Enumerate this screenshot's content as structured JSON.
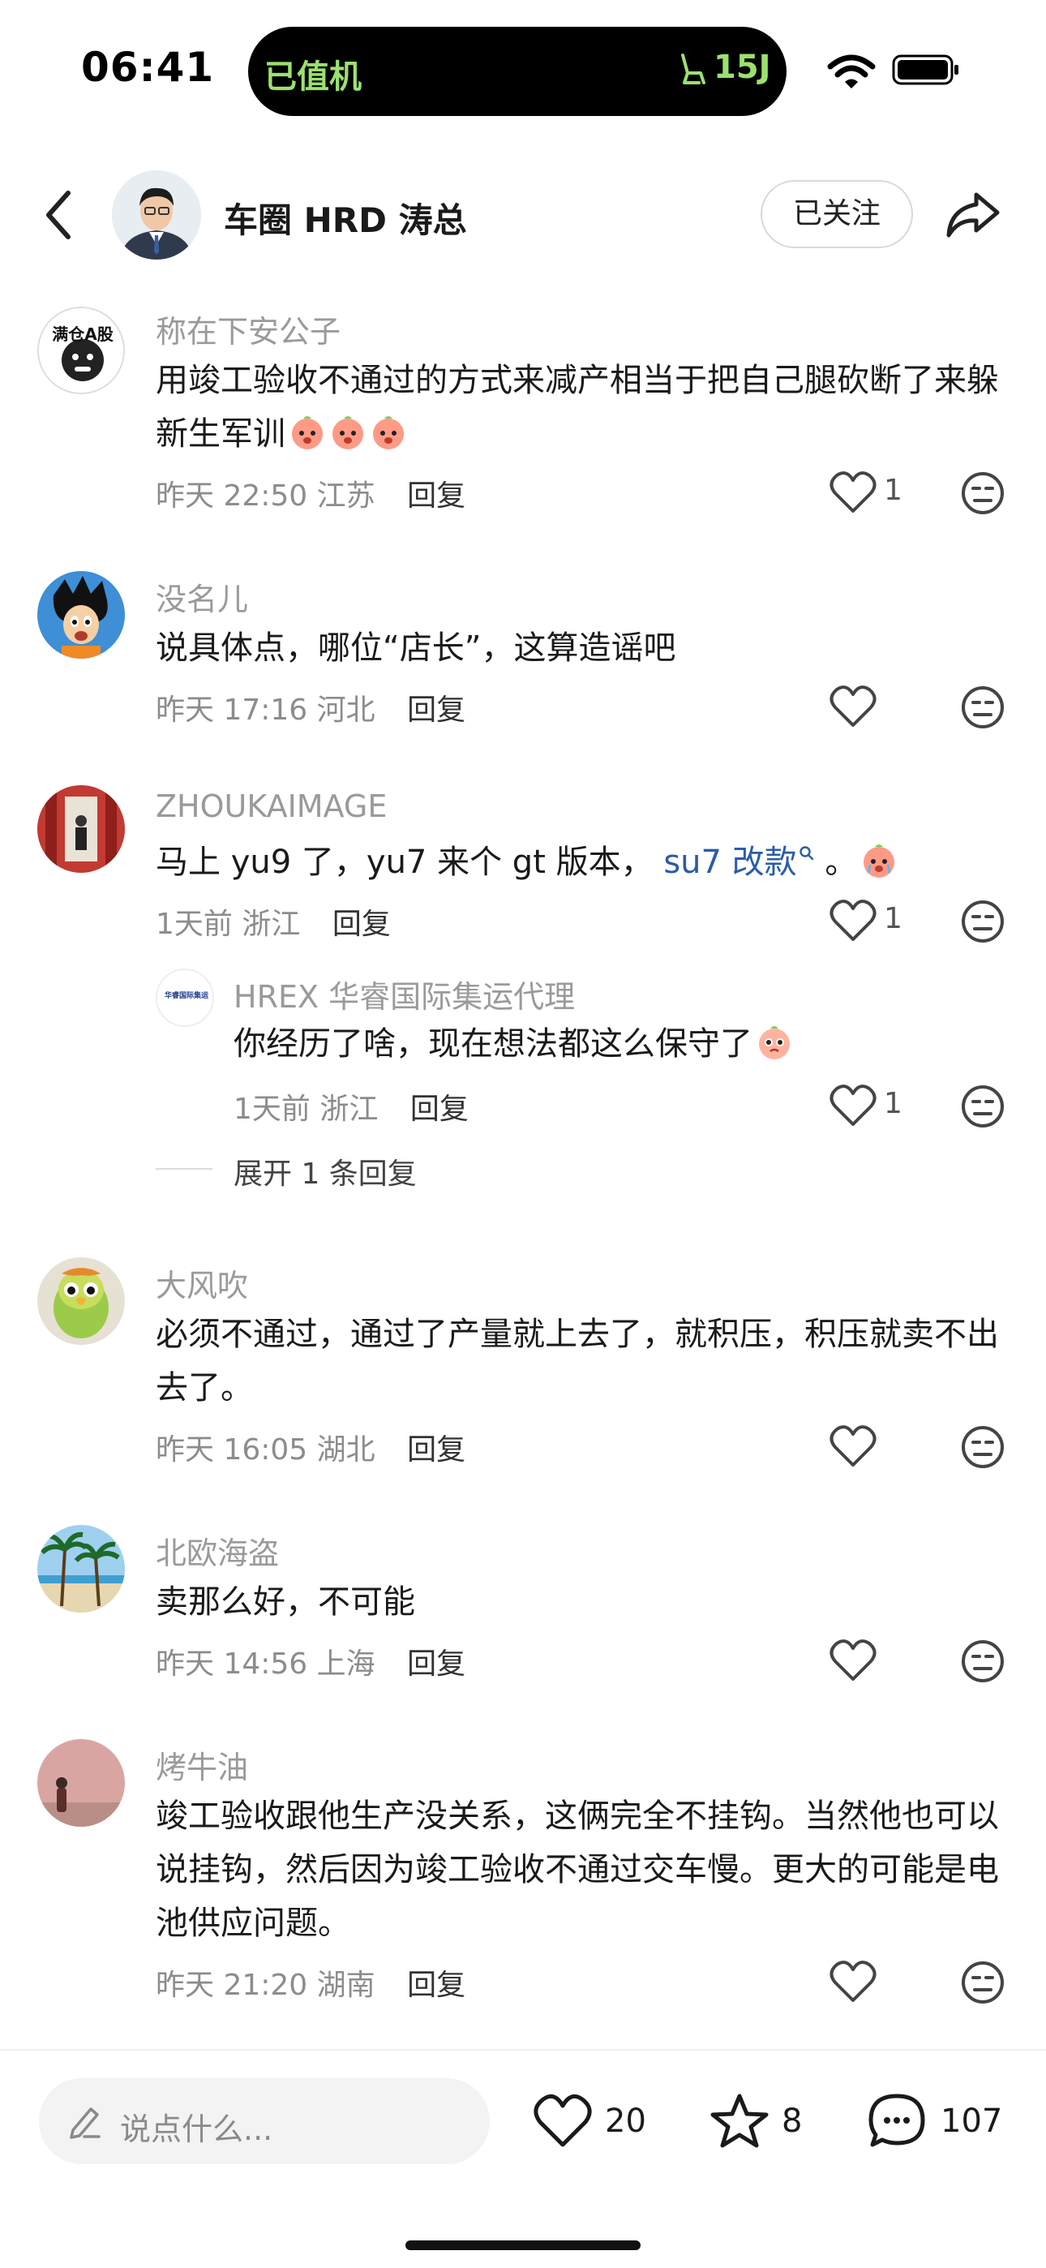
{
  "status": {
    "time": "06:41",
    "island_label": "已值机",
    "seat_icon": "seat-icon",
    "flight": "15J"
  },
  "header": {
    "author": "车圈 HRD 涛总",
    "follow_label": "已关注"
  },
  "comments": [
    {
      "user": "称在下安公子",
      "avatar_text": "满仓A股",
      "text": "用竣工验收不通过的方式来减产相当于把自己腿砍断了来躲新生军训",
      "time": "昨天 22:50",
      "location": "江苏",
      "reply": "回复",
      "likes": "1"
    },
    {
      "user": "没名儿",
      "text": "说具体点，哪位“店长”，这算造谣吧",
      "time": "昨天 17:16",
      "location": "河北",
      "reply": "回复",
      "likes": ""
    },
    {
      "user": "ZHOUKAIMAGE",
      "text_before": "马上 yu9 了，yu7 来个 gt 版本，",
      "link": "su7 改款",
      "text_after": "。",
      "time": "1天前",
      "location": "浙江",
      "reply": "回复",
      "likes": "1"
    },
    {
      "user": "大风吹",
      "text": "必须不通过，通过了产量就上去了，就积压，积压就卖不出去了。",
      "time": "昨天 16:05",
      "location": "湖北",
      "reply": "回复",
      "likes": ""
    },
    {
      "user": "北欧海盗",
      "text": "卖那么好，不可能",
      "time": "昨天 14:56",
      "location": "上海",
      "reply": "回复",
      "likes": ""
    },
    {
      "user": "烤牛油",
      "text": "竣工验收跟他生产没关系，这俩完全不挂钩。当然他也可以说挂钩，然后因为竣工验收不通过交车慢。更大的可能是电池供应问题。",
      "time": "昨天 21:20",
      "location": "湖南",
      "reply": "回复",
      "likes": ""
    }
  ],
  "sub_reply": {
    "user": "HREX 华睿国际集运代理",
    "avatar_text": "华睿国际集运",
    "text": "你经历了啥，现在想法都这么保守了",
    "time": "1天前",
    "location": "浙江",
    "reply": "回复",
    "likes": "1",
    "expand": "展开 1 条回复"
  },
  "bottom": {
    "placeholder": "说点什么...",
    "likes": "20",
    "stars": "8",
    "comments": "107"
  }
}
